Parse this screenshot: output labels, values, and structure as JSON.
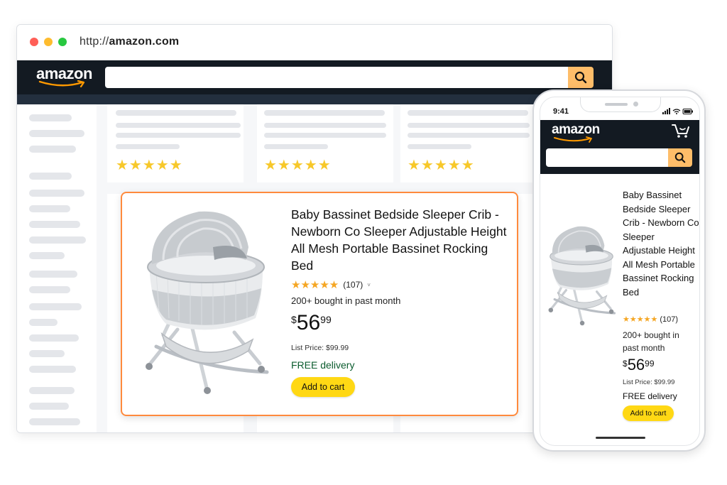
{
  "browser": {
    "url_prefix": "http://",
    "url_domain": "amazon.com",
    "logo": "amazon",
    "search_icon": "search-icon"
  },
  "grid": {
    "stars": [
      "★★★★★",
      "★★★★★",
      "★★★★★"
    ]
  },
  "product": {
    "title": "Baby Bassinet Bedside Sleeper Crib - Newborn Co Sleeper Adjustable Height All Mesh Portable Bassinet Rocking Bed",
    "stars": "★★★★★",
    "reviews": "(107)",
    "bought": "200+ bought in past month",
    "price_currency": "$",
    "price_whole": "56",
    "price_fraction": "99",
    "list_price": "List Price: $99.99",
    "delivery": "FREE delivery",
    "add_to_cart": "Add to cart",
    "rating_value": 4.5
  },
  "phone": {
    "time": "9:41",
    "logo": "amazon",
    "title": "Baby Bassinet Bedside Sleeper Crib - Newborn Co Sleeper Adjustable Height All Mesh Portable Bassinet Rocking Bed",
    "stars": "★★★★★",
    "reviews": "(107)",
    "bought": "200+ bought in past month",
    "price_currency": "$",
    "price_whole": "56",
    "price_fraction": "99",
    "list_price": "List Price: $99.99",
    "delivery": "FREE delivery",
    "add_to_cart": "Add to cart"
  },
  "colors": {
    "nav": "#131a22",
    "search_button": "#febd69",
    "cart_button": "#ffd814",
    "star": "#f5a623",
    "highlight_border": "#ff8a3d",
    "delivery": "#0b5c2e"
  }
}
